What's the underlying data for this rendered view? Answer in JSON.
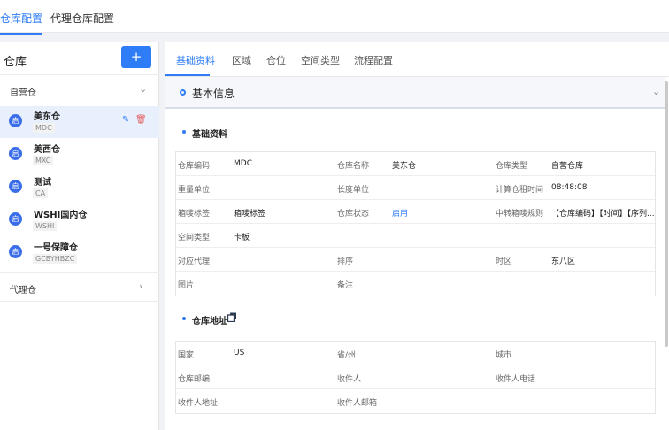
{
  "top_tabs": [
    "仓库配置",
    "代理仓库配置"
  ],
  "left": {
    "title": "仓库",
    "add_label": "+",
    "group_self": "自营仓",
    "group_agent": "代理仓",
    "warehouses": [
      {
        "name": "美东仓",
        "code": "MDC",
        "avatar": "启"
      },
      {
        "name": "美西仓",
        "code": "MXC",
        "avatar": "启"
      },
      {
        "name": "测试",
        "code": "CA",
        "avatar": "启"
      },
      {
        "name": "WSHI国内仓",
        "code": "WSHI",
        "avatar": "启"
      },
      {
        "name": "一号保障仓",
        "code": "GCBYHBZC",
        "avatar": "启"
      }
    ]
  },
  "right": {
    "tabs": [
      "基础资料",
      "区域",
      "仓位",
      "空间类型",
      "流程配置"
    ],
    "section_title": "基本信息",
    "basic": {
      "title": "基础资料",
      "rows": [
        [
          [
            "仓库编码",
            "MDC",
            false
          ],
          [
            "仓库名称",
            "美东仓",
            false
          ],
          [
            "仓库类型",
            "自营仓库",
            false
          ]
        ],
        [
          [
            "重量单位",
            "",
            false
          ],
          [
            "长度单位",
            "",
            false
          ],
          [
            "计算仓租时间",
            "08:48:08",
            false
          ]
        ],
        [
          [
            "箱唛标签",
            "箱唛标签",
            false
          ],
          [
            "仓库状态",
            "启用",
            true
          ],
          [
            "中转箱唛规则",
            "【仓库编码】【时间】【序列...",
            false
          ]
        ],
        [
          [
            "空间类型",
            "卡板",
            false
          ],
          [
            "",
            "",
            false
          ],
          [
            "",
            "",
            false
          ]
        ],
        [
          [
            "对应代理",
            "",
            false
          ],
          [
            "排序",
            "",
            false
          ],
          [
            "时区",
            "东八区",
            false
          ]
        ],
        [
          [
            "图片",
            "",
            false
          ],
          [
            "备注",
            "",
            false
          ],
          [
            "",
            "",
            false
          ]
        ]
      ]
    },
    "address": {
      "title": "仓库地址",
      "rows": [
        [
          [
            "国家",
            "US"
          ],
          [
            "省/州",
            ""
          ],
          [
            "城市",
            ""
          ]
        ],
        [
          [
            "仓库邮编",
            ""
          ],
          [
            "收件人",
            ""
          ],
          [
            "收件人电话",
            ""
          ]
        ],
        [
          [
            "收件人地址",
            ""
          ],
          [
            "收件人邮箱",
            ""
          ],
          [
            "",
            ""
          ]
        ]
      ]
    }
  },
  "colors": {
    "accent": "#2f7df6",
    "danger": "#e35c5c",
    "avatar": "#3a6ee8"
  },
  "icons": {
    "edit": "edit-icon",
    "delete": "delete-icon",
    "copy": "copy-icon",
    "chevron": "chevron-icon"
  }
}
